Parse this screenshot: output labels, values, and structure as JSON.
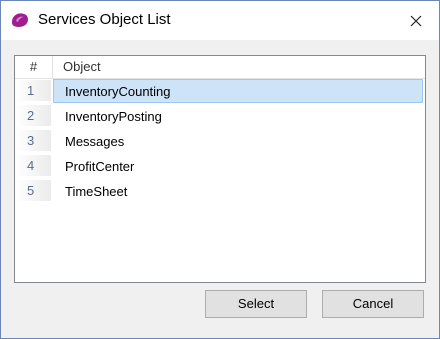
{
  "window": {
    "title": "Services Object List"
  },
  "table": {
    "columns": [
      "#",
      "Object"
    ],
    "rows": [
      {
        "num": "1",
        "object": "InventoryCounting",
        "selected": true
      },
      {
        "num": "2",
        "object": "InventoryPosting"
      },
      {
        "num": "3",
        "object": "Messages"
      },
      {
        "num": "4",
        "object": "ProfitCenter"
      },
      {
        "num": "5",
        "object": "TimeSheet"
      }
    ]
  },
  "buttons": {
    "select": "Select",
    "cancel": "Cancel"
  },
  "colors": {
    "selection": "#cde3f8",
    "selection_border": "#99c9f4",
    "window_border": "#6b86b8"
  }
}
